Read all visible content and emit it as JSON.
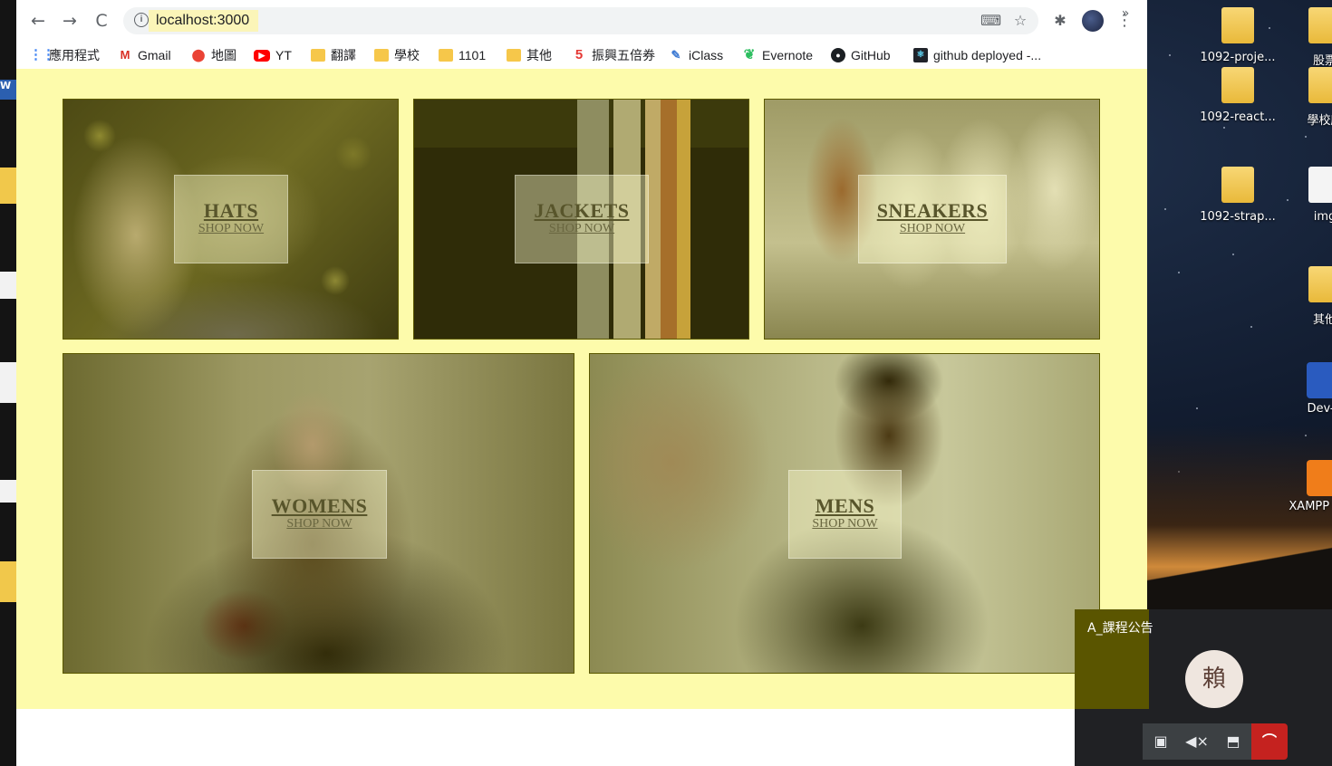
{
  "browser": {
    "url": "localhost:3000",
    "nav": {
      "back": "←",
      "forward": "→",
      "reload": "C",
      "info": "i"
    },
    "bookmarks": [
      {
        "label": "應用程式",
        "glyph": "⋮⋮",
        "cls": "ic-apps"
      },
      {
        "label": "Gmail",
        "glyph": "M",
        "cls": "ic-gmail"
      },
      {
        "label": "地圖",
        "glyph": "⬤",
        "cls": "ic-maps"
      },
      {
        "label": "YT",
        "glyph": "▶",
        "cls": "ic-yt"
      },
      {
        "label": "翻譯",
        "glyph": "",
        "cls": "ic-folder"
      },
      {
        "label": "學校",
        "glyph": "",
        "cls": "ic-folder"
      },
      {
        "label": "1101",
        "glyph": "",
        "cls": "ic-folder"
      },
      {
        "label": "其他",
        "glyph": "",
        "cls": "ic-folder"
      },
      {
        "label": "振興五倍券",
        "glyph": "5",
        "cls": "ic-5"
      },
      {
        "label": "iClass",
        "glyph": "✎",
        "cls": "ic-iclass"
      },
      {
        "label": "Evernote",
        "glyph": "❦",
        "cls": "ic-evernote"
      },
      {
        "label": "GitHub",
        "glyph": "●",
        "cls": "ic-github"
      },
      {
        "label": "github deployed -...",
        "glyph": "⚛",
        "cls": "ic-react"
      }
    ],
    "more_bookmarks": "»"
  },
  "menu": {
    "items": [
      {
        "title": "HATS",
        "subtitle": "SHOP NOW"
      },
      {
        "title": "JACKETS",
        "subtitle": "SHOP NOW"
      },
      {
        "title": "SNEAKERS",
        "subtitle": "SHOP NOW"
      },
      {
        "title": "WOMENS",
        "subtitle": "SHOP NOW"
      },
      {
        "title": "MENS",
        "subtitle": "SHOP NOW"
      }
    ]
  },
  "meet": {
    "label": "A_課程公告",
    "avatar_letter": "賴"
  },
  "desktop": {
    "icons": [
      {
        "label": "1092-proje...",
        "type": "folder"
      },
      {
        "label": "股票",
        "type": "folder"
      },
      {
        "label": "1092-react...",
        "type": "folder"
      },
      {
        "label": "學校所",
        "type": "folder"
      },
      {
        "label": "1092-strap...",
        "type": "folder"
      },
      {
        "label": "img",
        "type": "file"
      },
      {
        "label": "其他",
        "type": "folder"
      },
      {
        "label": "Dev-C",
        "type": "app"
      },
      {
        "label": "XAMPP Cont",
        "type": "app"
      }
    ]
  }
}
